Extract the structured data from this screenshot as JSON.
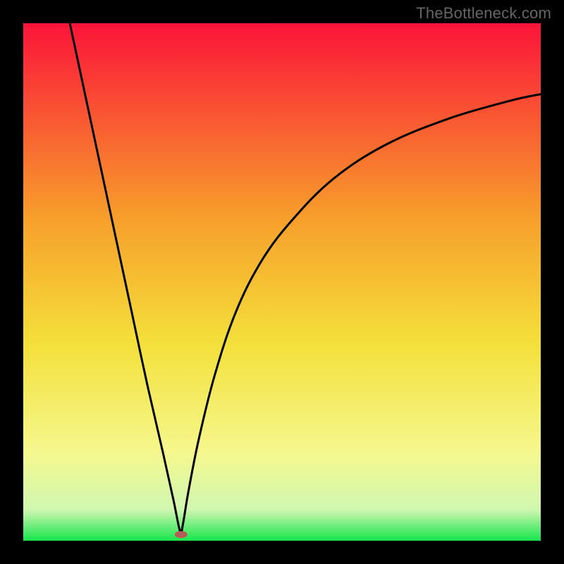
{
  "watermark": "TheBottleneck.com",
  "chart_data": {
    "type": "line",
    "title": "",
    "xlabel": "",
    "ylabel": "",
    "xlim": [
      0,
      100
    ],
    "ylim": [
      0,
      100
    ],
    "grid": false,
    "legend": false,
    "background_gradient": {
      "top": "#fb1439",
      "upper_mid": "#f7a02b",
      "mid": "#f4e03a",
      "lower": "#f5f88e",
      "band": "#d0f7b0",
      "bottom": "#16e54c"
    },
    "marker": {
      "x": 30.5,
      "y": 1.2,
      "color": "#b65a5a",
      "rx": 9,
      "ry": 5
    },
    "series": [
      {
        "name": "left-branch",
        "x": [
          9,
          12,
          15,
          18,
          21,
          24,
          27,
          29,
          30,
          30.5
        ],
        "values": [
          100,
          86,
          72,
          58,
          44,
          30,
          17,
          8,
          3,
          1.2
        ]
      },
      {
        "name": "right-branch",
        "x": [
          30.5,
          31,
          32,
          34,
          37,
          41,
          46,
          52,
          60,
          70,
          82,
          94,
          100
        ],
        "values": [
          1.2,
          4,
          10,
          20,
          32,
          44,
          54,
          62,
          70,
          76.5,
          81.5,
          85,
          86.3
        ]
      }
    ]
  }
}
